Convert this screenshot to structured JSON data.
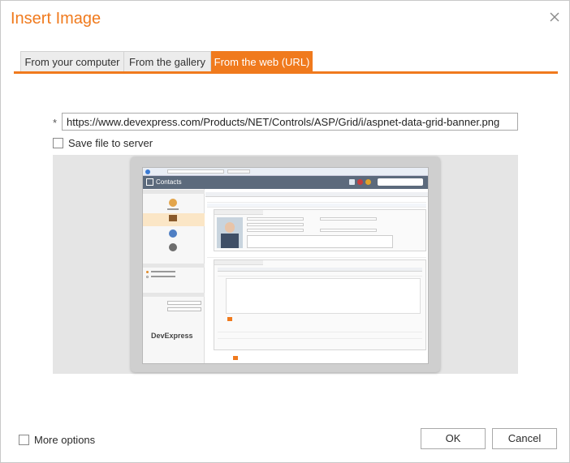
{
  "dialog": {
    "title": "Insert Image"
  },
  "tabs": [
    {
      "label": "From your computer",
      "active": false
    },
    {
      "label": "From the gallery",
      "active": false
    },
    {
      "label": "From the web (URL)",
      "active": true
    }
  ],
  "url_field": {
    "required_marker": "*",
    "value": "https://www.devexpress.com/Products/NET/Controls/ASP/Grid/i/aspnet-data-grid-banner.png"
  },
  "save_file": {
    "label": "Save file to server",
    "checked": false
  },
  "preview": {
    "screen_brand": "DevExpress",
    "screen_module": "Contacts"
  },
  "footer": {
    "more_options_label": "More options",
    "more_options_checked": false,
    "ok_label": "OK",
    "cancel_label": "Cancel"
  },
  "colors": {
    "accent": "#f07a1d",
    "tab_bg": "#ececec",
    "preview_bg": "#e5e5e5"
  }
}
